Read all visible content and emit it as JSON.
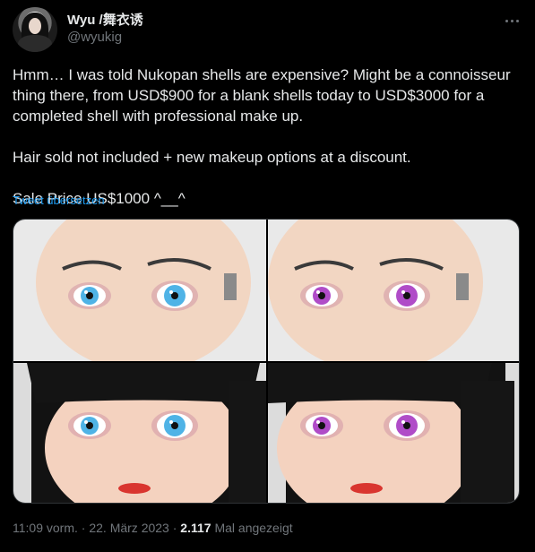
{
  "author": {
    "display_name": "Wyu /舞衣诱",
    "handle": "@wyukig"
  },
  "tweet": {
    "paragraphs": [
      "Hmm… I was told Nukopan shells are expensive? Might be a connoisseur thing there, from USD$900 for a blank shells today to USD$3000 for a completed shell with professional make up.",
      "Hair sold not included + new makeup options at a discount.",
      "Sale Price US$1000 ^__^"
    ],
    "translate_label": "Tweet übersetzen"
  },
  "media": [
    {
      "name": "bald-shell-blue-eyes",
      "hair": false,
      "eye_color": "#4fb3e6"
    },
    {
      "name": "bald-shell-purple-eyes",
      "hair": false,
      "eye_color": "#b04cc8"
    },
    {
      "name": "black-hair-blue-eyes",
      "hair": true,
      "eye_color": "#4fb3e6"
    },
    {
      "name": "black-hair-purple-eyes",
      "hair": true,
      "eye_color": "#b04cc8"
    }
  ],
  "meta": {
    "time": "11:09 vorm.",
    "separator": "·",
    "date": "22. März 2023",
    "views_count": "2.117",
    "views_label": "Mal angezeigt"
  },
  "colors": {
    "background": "#000000",
    "text": "#e7e9ea",
    "secondary": "#71767b",
    "link": "#1d9bf0"
  }
}
